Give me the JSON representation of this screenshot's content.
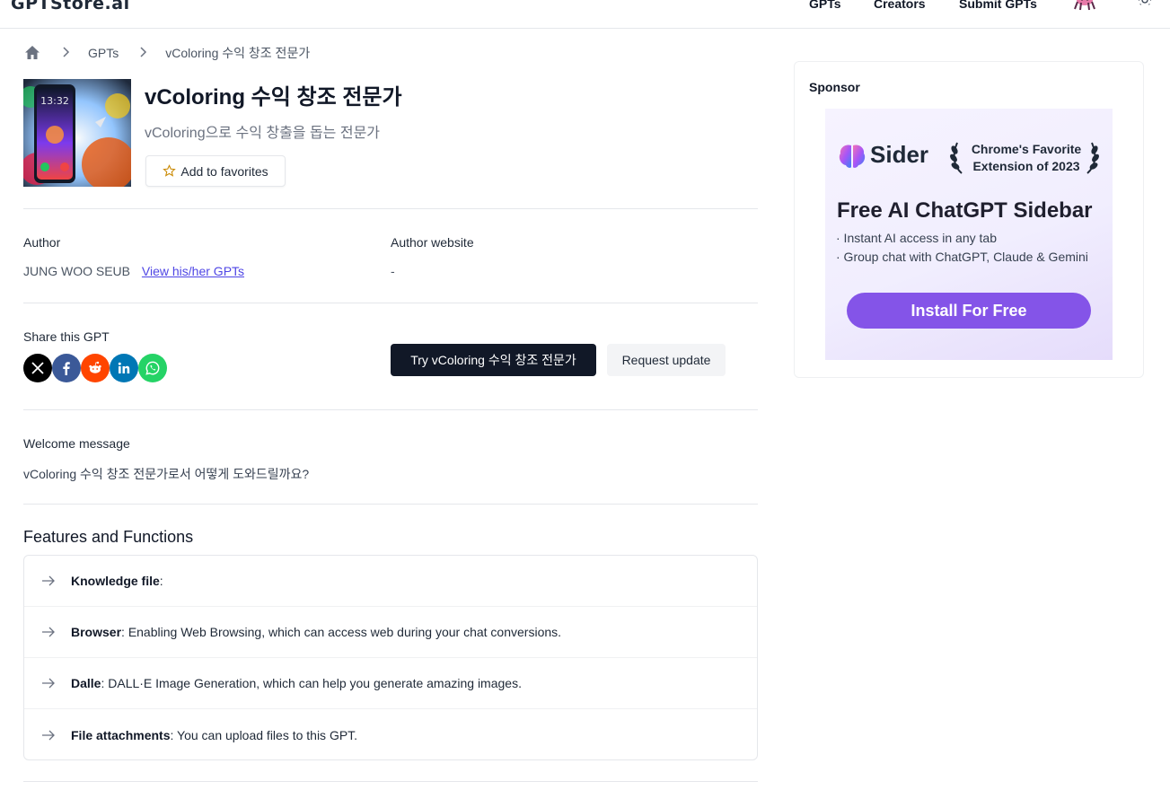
{
  "header": {
    "logo": "GPTStore.ai",
    "nav": [
      "GPTs",
      "Creators",
      "Submit GPTs"
    ]
  },
  "breadcrumb": {
    "items": [
      "GPTs",
      "vColoring 수익 창조 전문가"
    ]
  },
  "gpt": {
    "title": "vColoring 수익 창조 전문가",
    "subtitle": "vColoring으로 수익 창출을 돕는 전문가",
    "favorite_label": "Add to favorites",
    "image_clock": "13:32"
  },
  "author": {
    "label": "Author",
    "name": "JUNG WOO SEUB",
    "link_text": "View his/her GPTs",
    "website_label": "Author website",
    "website_value": "-"
  },
  "share": {
    "label": "Share this GPT",
    "networks": [
      "x",
      "facebook",
      "reddit",
      "linkedin",
      "whatsapp"
    ]
  },
  "actions": {
    "try_label": "Try vColoring 수익 창조 전문가",
    "request_label": "Request update"
  },
  "welcome": {
    "label": "Welcome message",
    "text": "vColoring 수익 창조 전문가로서 어떻게 도와드릴까요?"
  },
  "features": {
    "title": "Features and Functions",
    "items": [
      {
        "name": "Knowledge file",
        "desc": ""
      },
      {
        "name": "Browser",
        "desc": "Enabling Web Browsing, which can access web during your chat conversions."
      },
      {
        "name": "Dalle",
        "desc": "DALL·E Image Generation, which can help you generate amazing images."
      },
      {
        "name": "File attachments",
        "desc": "You can upload files to this GPT."
      }
    ]
  },
  "sponsor": {
    "label": "Sponsor",
    "ad": {
      "brand": "Sider",
      "award_line1": "Chrome's Favorite",
      "award_line2": "Extension of 2023",
      "headline": "Free AI ChatGPT Sidebar",
      "bullets": [
        "· Instant AI access in any tab",
        "· Group chat with ChatGPT, Claude & Gemini"
      ],
      "cta": "Install For Free"
    }
  },
  "colors": {
    "accent_link": "#4f46e5",
    "primary_button": "#111827",
    "ad_cta": "#8454e8",
    "x": "#000000",
    "facebook": "#3b5998",
    "reddit": "#ff4500",
    "linkedin": "#0077b5",
    "whatsapp": "#25d366"
  }
}
